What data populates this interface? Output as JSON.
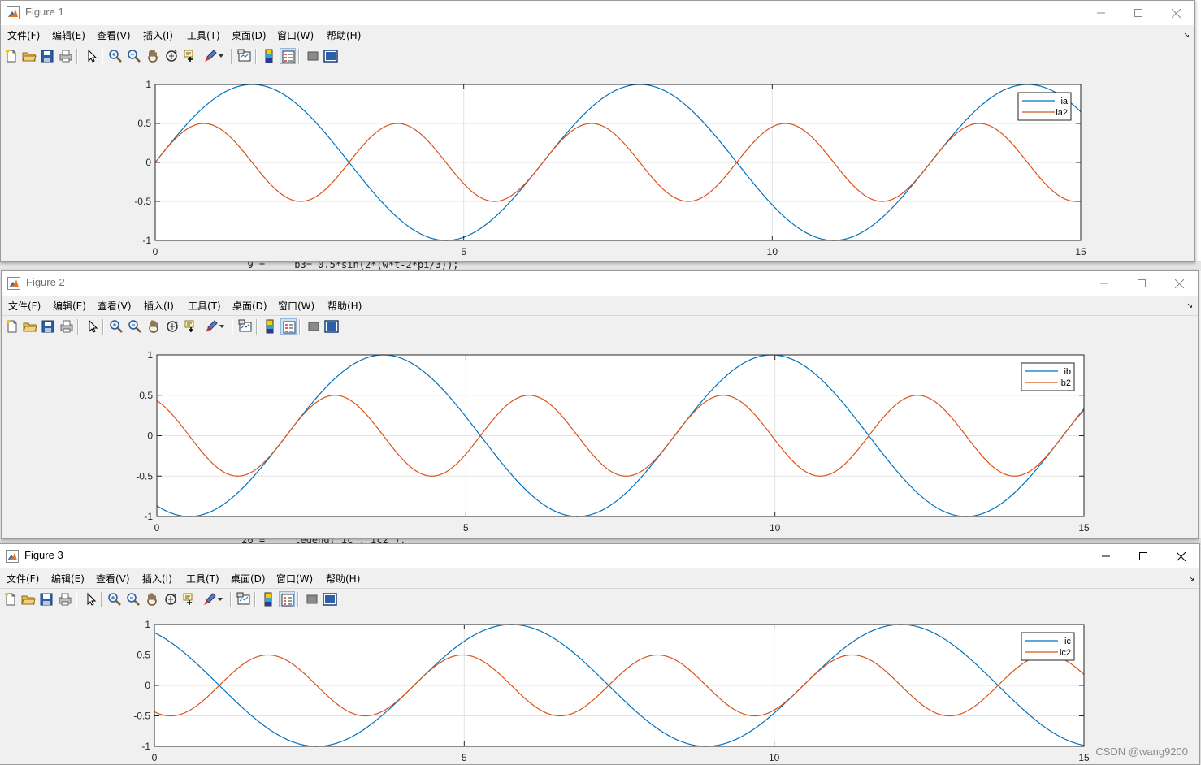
{
  "background_code": {
    "line1": "  9 =     b3= 0.5*sin(2*(w*t-2*pi/3));",
    "line2": " 26 =     legend('ic','ic2');"
  },
  "watermark": "CSDN @wang9200",
  "colors": {
    "series1": "#0072BD",
    "series2": "#D95319",
    "grid": "#e3e3e3",
    "axis": "#262626"
  },
  "menus": [
    "文件(F)",
    "编辑(E)",
    "查看(V)",
    "插入(I)",
    "工具(T)",
    "桌面(D)",
    "窗口(W)",
    "帮助(H)"
  ],
  "toolbar_icons": [
    "new-figure-icon",
    "open-file-icon",
    "save-icon",
    "print-icon",
    "edit-plot-arrow-icon",
    "zoom-in-icon",
    "zoom-out-icon",
    "pan-hand-icon",
    "rotate-3d-icon",
    "data-cursor-icon",
    "brush-icon",
    "brush-dropdown-icon",
    "link-plot-icon",
    "insert-colorbar-icon",
    "insert-legend-icon",
    "hide-plot-tools-icon",
    "show-plot-tools-icon"
  ],
  "figures": [
    {
      "title": "Figure 1",
      "chart_data": {
        "type": "line",
        "xlim": [
          0,
          15
        ],
        "ylim": [
          -1,
          1
        ],
        "xticks": [
          "0",
          "5",
          "10",
          "15"
        ],
        "yticks": [
          "1",
          "0.5",
          "0",
          "-0.5",
          "-1"
        ],
        "grid": true,
        "legend_position": "top-right",
        "series": [
          {
            "name": "ia",
            "function": "sin(w*t)",
            "amplitude": 1,
            "harmonic": 1,
            "phase": 0
          },
          {
            "name": "ia2",
            "function": "0.5*sin(2*w*t)",
            "amplitude": 0.5,
            "harmonic": 2,
            "phase": 0
          }
        ],
        "w": 1
      }
    },
    {
      "title": "Figure 2",
      "chart_data": {
        "type": "line",
        "xlim": [
          0,
          15
        ],
        "ylim": [
          -1,
          1
        ],
        "xticks": [
          "0",
          "5",
          "10",
          "15"
        ],
        "yticks": [
          "1",
          "0.5",
          "0",
          "-0.5",
          "-1"
        ],
        "grid": true,
        "legend_position": "top-right",
        "series": [
          {
            "name": "ib",
            "function": "sin(w*t-2*pi/3)",
            "amplitude": 1,
            "harmonic": 1,
            "phase": -2.0944
          },
          {
            "name": "ib2",
            "function": "0.5*sin(2*(w*t-2*pi/3))",
            "amplitude": 0.5,
            "harmonic": 2,
            "phase": -2.0944
          }
        ],
        "w": 1
      }
    },
    {
      "title": "Figure 3",
      "chart_data": {
        "type": "line",
        "xlim": [
          0,
          15
        ],
        "ylim": [
          -1,
          1
        ],
        "xticks": [
          "0",
          "5",
          "10",
          "15"
        ],
        "yticks": [
          "1",
          "0.5",
          "0",
          "-0.5",
          "-1"
        ],
        "grid": true,
        "legend_position": "top-right",
        "series": [
          {
            "name": "ic",
            "function": "sin(w*t+2*pi/3)",
            "amplitude": 1,
            "harmonic": 1,
            "phase": 2.0944
          },
          {
            "name": "ic2",
            "function": "0.5*sin(2*(w*t+2*pi/3))",
            "amplitude": 0.5,
            "harmonic": 2,
            "phase": 2.0944
          }
        ],
        "w": 1
      }
    }
  ]
}
